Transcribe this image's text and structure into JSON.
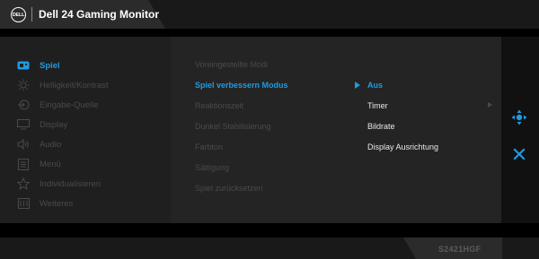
{
  "header": {
    "logo_text": "DELL",
    "title": "Dell 24 Gaming Monitor"
  },
  "sidebar": {
    "items": [
      {
        "label": "Spiel",
        "icon": "gamepad-icon",
        "active": true
      },
      {
        "label": "Helligkeit/Kontrast",
        "icon": "brightness-icon",
        "active": false
      },
      {
        "label": "Eingabe-Quelle",
        "icon": "input-source-icon",
        "active": false
      },
      {
        "label": "Display",
        "icon": "display-icon",
        "active": false
      },
      {
        "label": "Audio",
        "icon": "speaker-icon",
        "active": false
      },
      {
        "label": "Menü",
        "icon": "menu-icon",
        "active": false
      },
      {
        "label": "Individualisieren",
        "icon": "star-icon",
        "active": false
      },
      {
        "label": "Weiteres",
        "icon": "others-icon",
        "active": false
      }
    ]
  },
  "submenu": {
    "items": [
      {
        "label": "Voreingestellte Modi",
        "active": false
      },
      {
        "label": "Spiel verbessern Modus",
        "active": true
      },
      {
        "label": "Reaktionszeit",
        "active": false
      },
      {
        "label": "Dunkel Stabilisierung",
        "active": false
      },
      {
        "label": "Farbton",
        "active": false
      },
      {
        "label": "Sättigung",
        "active": false
      },
      {
        "label": "Spiel zurücksetzen",
        "active": false
      }
    ]
  },
  "options": {
    "items": [
      {
        "label": "Aus",
        "active": true
      },
      {
        "label": "Timer",
        "active": false
      },
      {
        "label": "Bildrate",
        "active": false
      },
      {
        "label": "Display Ausrichtung",
        "active": false
      }
    ]
  },
  "footer": {
    "model": "S2421HGF"
  },
  "colors": {
    "accent": "#1e9be3",
    "inactive_text": "#4a4a4a",
    "option_text": "#e8e8e8",
    "background": "#000000"
  },
  "controls": {
    "nav_icon": "joystick-nav-icon",
    "close_icon": "close-icon"
  }
}
